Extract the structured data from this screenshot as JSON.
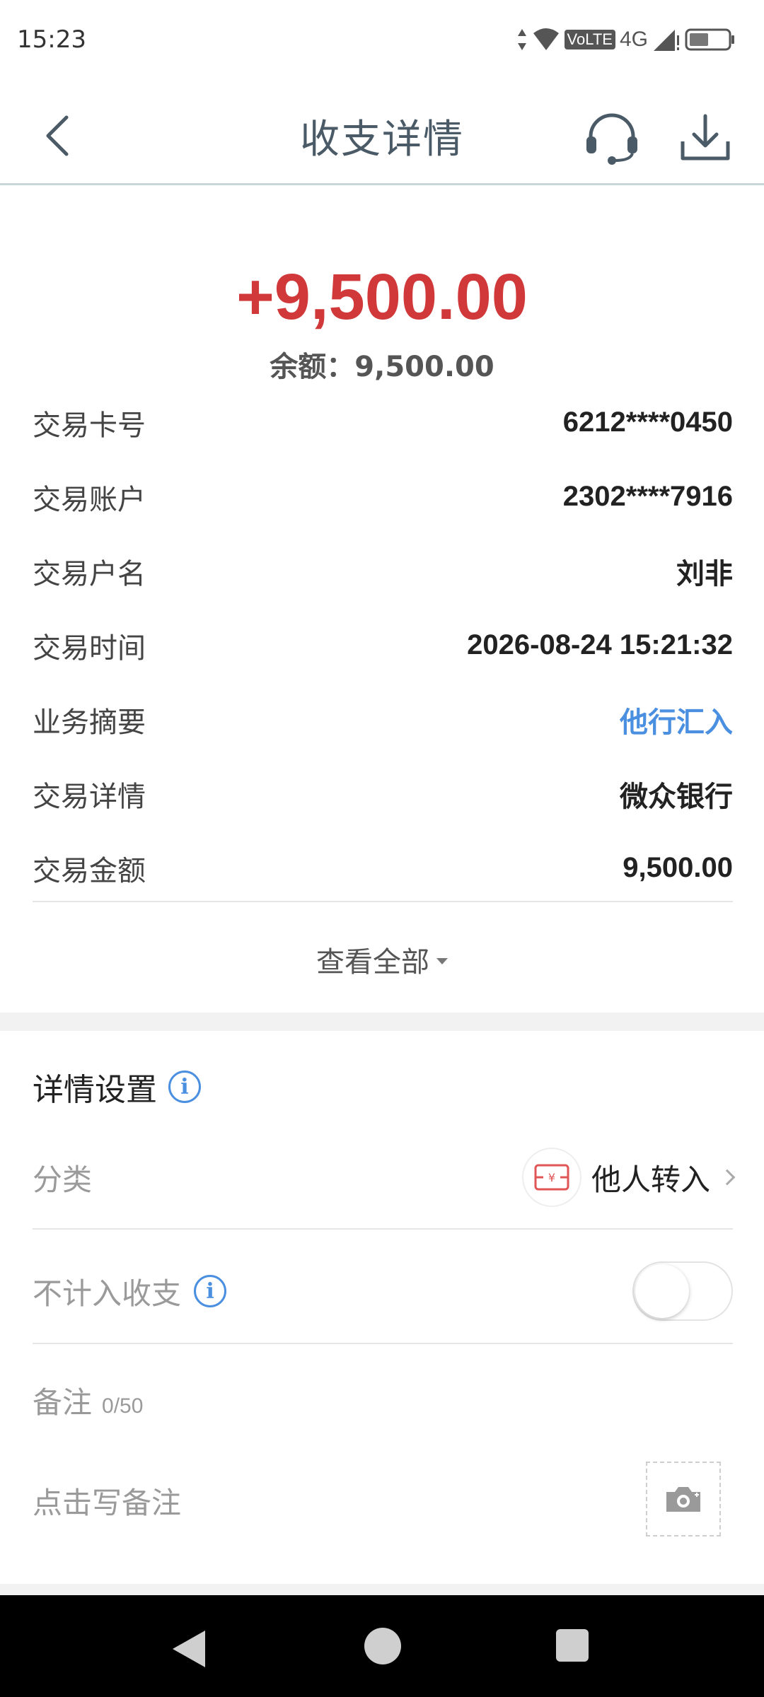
{
  "status_bar": {
    "time": "15:23",
    "volte": "VoLTE",
    "network": "4G"
  },
  "header": {
    "title": "收支详情",
    "icons": [
      "back-icon",
      "headset-icon",
      "download-icon"
    ]
  },
  "summary": {
    "amount": "+9,500.00",
    "balance": "余额：9,500.00",
    "amount_color": "#d0383a"
  },
  "details": [
    {
      "label": "交易卡号",
      "value": "6212****0450"
    },
    {
      "label": "交易账户",
      "value": "2302****7916"
    },
    {
      "label": "交易户名",
      "value": "刘非"
    },
    {
      "label": "交易时间",
      "value": "2026-08-24 15:21:32"
    },
    {
      "label": "业务摘要",
      "value": "他行汇入"
    },
    {
      "label": "交易详情",
      "value": "微众银行"
    },
    {
      "label": "交易金额",
      "value": "9,500.00"
    }
  ],
  "view_all": "查看全部",
  "settings": {
    "title": "详情设置",
    "category_label": "分类",
    "category_value": "他人转入",
    "exclude_label": "不计入收支",
    "exclude_enabled": false,
    "remark_label": "备注",
    "remark_count": "0/50",
    "remark_placeholder": "点击写备注"
  },
  "colors": {
    "accent_blue": "#4a8fe0",
    "category_red": "#e05555"
  }
}
